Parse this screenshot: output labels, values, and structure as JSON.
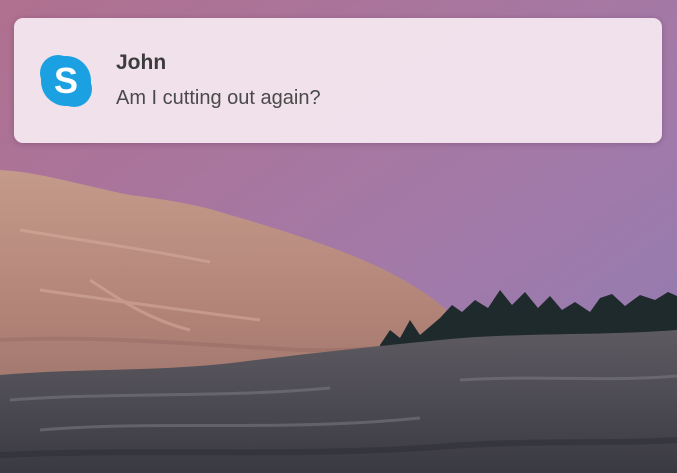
{
  "desktop": {
    "wallpaper_icon": "mountain-landscape",
    "colors": {
      "sky_top": "#a87292",
      "sky_bottom": "#9a78ae",
      "rock": "#b88a7c",
      "trees": "#1f2a2c"
    }
  },
  "notification": {
    "app_icon": "skype-icon",
    "app_icon_letter": "S",
    "icon_color": "#1ba0e1",
    "sender": "John",
    "message": "Am I cutting out again?"
  }
}
